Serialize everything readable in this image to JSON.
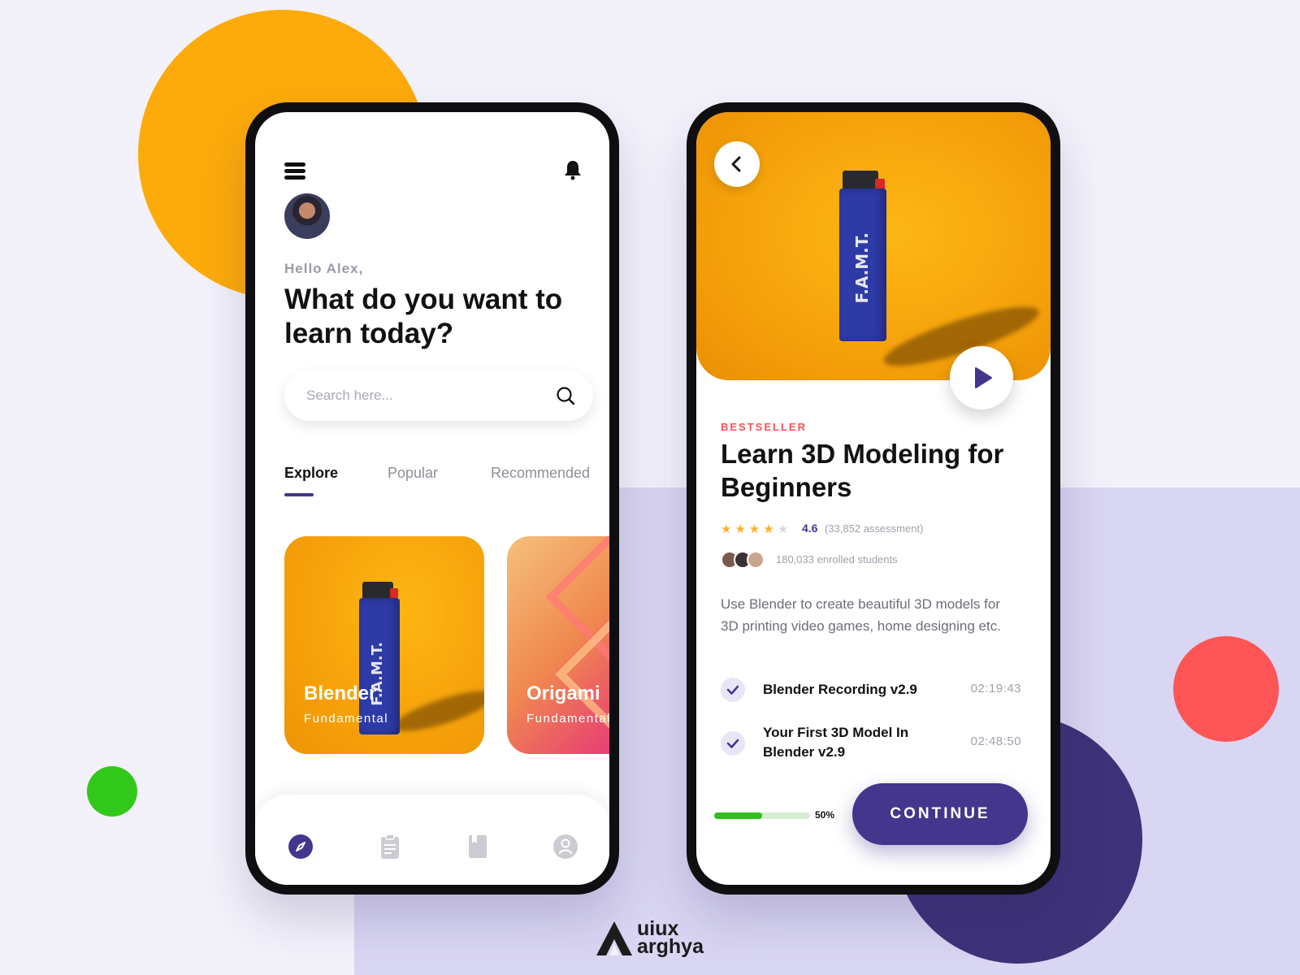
{
  "left_screen": {
    "greeting": "Hello Alex,",
    "headline": "What do you want to learn today?",
    "search": {
      "placeholder": "Search here..."
    },
    "tabs": [
      {
        "label": "Explore",
        "active": true
      },
      {
        "label": "Popular",
        "active": false
      },
      {
        "label": "Recommended",
        "active": false
      }
    ],
    "cards": [
      {
        "title": "Blender",
        "subtitle": "Fundamental",
        "lighter_text": "F.A.M.T."
      },
      {
        "title": "Origami",
        "subtitle": "Fundamental"
      }
    ],
    "bottom_nav": [
      {
        "icon": "compass-icon",
        "active": true
      },
      {
        "icon": "clipboard-icon",
        "active": false
      },
      {
        "icon": "book-icon",
        "active": false
      },
      {
        "icon": "profile-icon",
        "active": false
      }
    ]
  },
  "right_screen": {
    "hero_lighter_text": "F.A.M.T.",
    "badge": "BESTSELLER",
    "title": "Learn 3D Modeling for Beginners",
    "rating": "4.6",
    "stars_filled": 4,
    "stars_total": 5,
    "assessments": "(33,852 assessment)",
    "enrolled": "180,033 enrolled students",
    "description": "Use Blender to create beautiful 3D models for 3D printing video games, home designing etc.",
    "lessons": [
      {
        "name": "Blender Recording v2.9",
        "duration": "02:19:43",
        "completed": true
      },
      {
        "name": "Your First 3D Model In Blender v2.9",
        "duration": "02:48:50",
        "completed": true
      }
    ],
    "progress": {
      "percent": 50,
      "label": "50%"
    },
    "continue_label": "CONTINUE"
  },
  "brand": {
    "line1": "uiux",
    "line2": "arghya"
  },
  "colors": {
    "accent": "#43368c",
    "orange": "#fdab0b",
    "red": "#fd5556",
    "green": "#32c81a",
    "badge": "#f55159"
  }
}
